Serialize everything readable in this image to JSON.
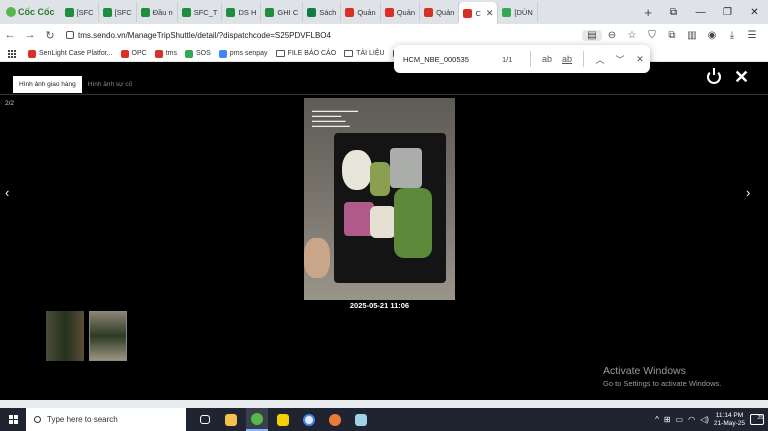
{
  "browser": {
    "brand": "Cốc Cốc",
    "tabs": [
      {
        "label": "[SFC",
        "color": "#1e8e3e"
      },
      {
        "label": "[SFC",
        "color": "#1e8e3e"
      },
      {
        "label": "Đầu n",
        "color": "#1e8e3e"
      },
      {
        "label": "SFC_T",
        "color": "#1e8e3e"
      },
      {
        "label": "DS H",
        "color": "#1e8e3e"
      },
      {
        "label": "GHI C",
        "color": "#1e8e3e"
      },
      {
        "label": "Sách",
        "color": "#107c41"
      },
      {
        "label": "Quản",
        "color": "#d93025"
      },
      {
        "label": "Quản",
        "color": "#d93025"
      },
      {
        "label": "Quản",
        "color": "#d93025"
      },
      {
        "label": "C",
        "color": "#d93025"
      },
      {
        "label": "[DÙN",
        "color": "#34a853"
      }
    ],
    "new_tab": "+",
    "url": "tms.sendo.vn/ManageTripShuttle/detail/?dispatchcode=S25PDVFLBO4",
    "bookmarks": [
      {
        "label": "SenLight Case Platfor...",
        "color": "#d93025"
      },
      {
        "label": "OPC",
        "color": "#d93025"
      },
      {
        "label": "tms",
        "color": "#d93025"
      },
      {
        "label": "SOS",
        "color": "#34a853"
      },
      {
        "label": "pms senpay",
        "color": "#4285f4"
      },
      {
        "label": "FILE BÁO CÁO",
        "type": "folder"
      },
      {
        "label": "TÀI LIỆU",
        "type": "folder"
      },
      {
        "label": "FILE C",
        "type": "folder"
      }
    ]
  },
  "find": {
    "query": "HCM_NBE_000535",
    "count": "1/1",
    "opt_case": "ab",
    "opt_word": "ab"
  },
  "viewer": {
    "tab_delivery": "Hình ảnh giao hàng",
    "tab_incident": "Hình ảnh sự cố",
    "counter": "2/2",
    "timestamp": "2025-05-21 11:06"
  },
  "watermark": {
    "title": "Activate Windows",
    "subtitle": "Go to Settings to activate Windows."
  },
  "taskbar": {
    "search_placeholder": "Type here to search",
    "time": "11:14 PM",
    "date": "21-May-25",
    "notifications": "25"
  }
}
